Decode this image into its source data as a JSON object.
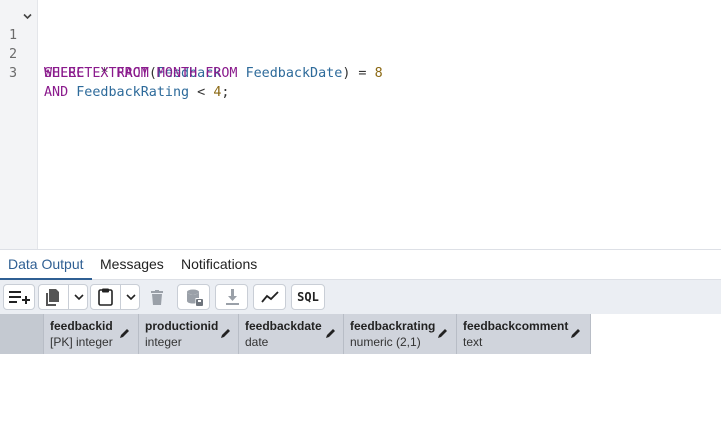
{
  "editor": {
    "lines": [
      {
        "number": "1",
        "tokens": [
          {
            "text": "SELECT",
            "cls": "kw"
          },
          {
            "text": " ",
            "cls": "op"
          },
          {
            "text": "*",
            "cls": "op"
          },
          {
            "text": " ",
            "cls": "op"
          },
          {
            "text": "FROM",
            "cls": "kw"
          },
          {
            "text": " ",
            "cls": "op"
          },
          {
            "text": "Feedback",
            "cls": "id"
          }
        ]
      },
      {
        "number": "2",
        "tokens": [
          {
            "text": "WHERE",
            "cls": "kw"
          },
          {
            "text": " ",
            "cls": "op"
          },
          {
            "text": "EXTRACT",
            "cls": "fn"
          },
          {
            "text": "(",
            "cls": "op"
          },
          {
            "text": "MONTH",
            "cls": "kw"
          },
          {
            "text": " ",
            "cls": "op"
          },
          {
            "text": "FROM",
            "cls": "kw"
          },
          {
            "text": " ",
            "cls": "op"
          },
          {
            "text": "FeedbackDate",
            "cls": "id"
          },
          {
            "text": ")",
            "cls": "op"
          },
          {
            "text": " = ",
            "cls": "op"
          },
          {
            "text": "8",
            "cls": "num"
          }
        ]
      },
      {
        "number": "3",
        "tokens": [
          {
            "text": "AND",
            "cls": "kw"
          },
          {
            "text": " ",
            "cls": "op"
          },
          {
            "text": "FeedbackRating",
            "cls": "id"
          },
          {
            "text": " < ",
            "cls": "op"
          },
          {
            "text": "4",
            "cls": "num"
          },
          {
            "text": ";",
            "cls": "op"
          }
        ]
      }
    ]
  },
  "tabs": {
    "data_output": "Data Output",
    "messages": "Messages",
    "notifications": "Notifications"
  },
  "toolbar": {
    "sql_label": "SQL"
  },
  "grid": {
    "columns": [
      {
        "name": "feedbackid",
        "type": "[PK] integer"
      },
      {
        "name": "productionid",
        "type": "integer"
      },
      {
        "name": "feedbackdate",
        "type": "date"
      },
      {
        "name": "feedbackrating",
        "type": "numeric (2,1)"
      },
      {
        "name": "feedbackcomment",
        "type": "text"
      }
    ]
  },
  "colors": {
    "keyword": "#8a1a8c",
    "identifier": "#2d6a9a",
    "number": "#8b6914",
    "active_tab": "#2f5f93"
  }
}
